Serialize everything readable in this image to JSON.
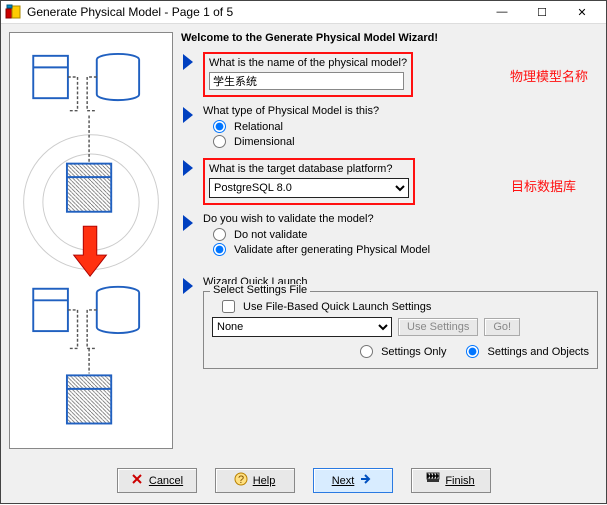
{
  "window": {
    "title": "Generate Physical Model - Page 1 of 5"
  },
  "controls": {
    "min": "—",
    "max": "☐",
    "close": "✕"
  },
  "welcome": "Welcome to the Generate Physical Model Wizard!",
  "q1": {
    "label": "What is the name of the physical model?",
    "value": "学生系统",
    "annotation": "物理模型名称"
  },
  "q2": {
    "label": "What type of Physical Model is this?",
    "opt1": "Relational",
    "opt2": "Dimensional"
  },
  "q3": {
    "label": "What is the target database platform?",
    "value": "PostgreSQL 8.0",
    "annotation": "目标数据库"
  },
  "q4": {
    "label": "Do you wish to validate the model?",
    "opt1": "Do not validate",
    "opt2": "Validate after generating Physical Model"
  },
  "q5": {
    "label": "Wizard Quick Launch",
    "group": "Select Settings File",
    "check": "Use File-Based Quick Launch Settings",
    "select": "None",
    "use_btn": "Use Settings",
    "go_btn": "Go!",
    "r1": "Settings Only",
    "r2": "Settings and Objects"
  },
  "footer": {
    "cancel": "Cancel",
    "help": "Help",
    "next": "Next",
    "finish": "Finish"
  }
}
